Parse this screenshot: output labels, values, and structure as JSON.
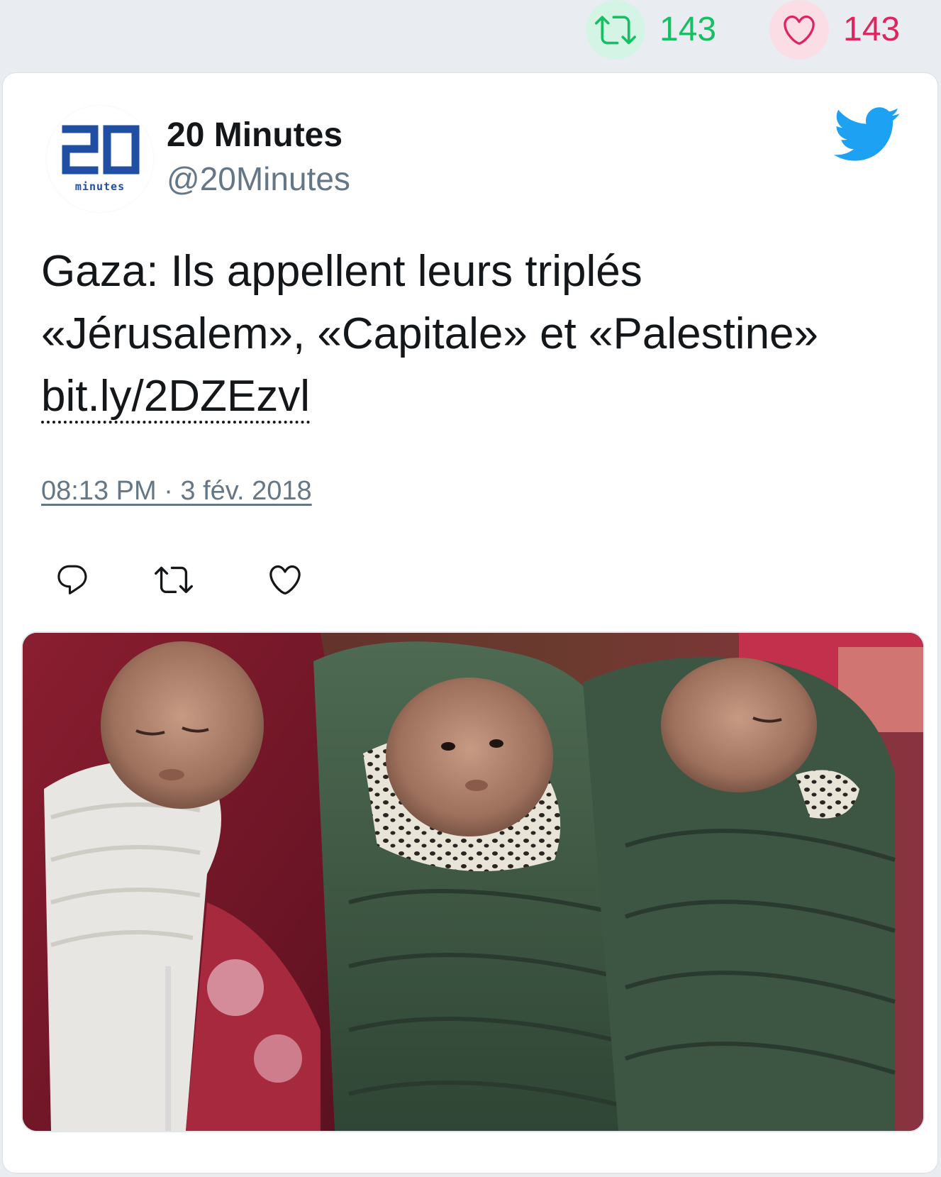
{
  "header_stats": {
    "retweets": "143",
    "likes": "143"
  },
  "tweet": {
    "author_name": "20 Minutes",
    "author_handle": "@20Minutes",
    "avatar_logo": {
      "digits": "20",
      "subtext": "minutes"
    },
    "text": "Gaza: Ils appellent leurs triplés «Jérusalem», «Capitale» et «Palestine» ",
    "link": "bit.ly/2DZEzvl",
    "timestamp": "08:13 PM · 3 fév. 2018",
    "platform_icon": "twitter-bird-icon",
    "action_icons": [
      "reply-icon",
      "retweet-icon",
      "like-icon"
    ],
    "media_description_icon": "photo"
  },
  "colors": {
    "retweet": "#17bf63",
    "like": "#e0245e",
    "twitter_blue": "#1da1f2",
    "logo_blue": "#1f4ea3",
    "secondary_text": "#657786"
  }
}
